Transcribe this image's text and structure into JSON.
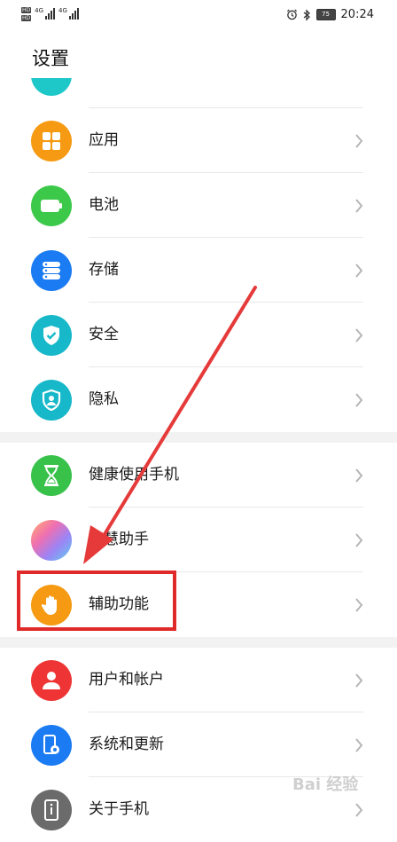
{
  "status_bar": {
    "time": "20:24",
    "battery": "75",
    "hd1": "HD",
    "hd2": "HD",
    "net1": "4G",
    "net2": "4G"
  },
  "page": {
    "title": "设置"
  },
  "items": [
    {
      "label": "",
      "icon": "teal-partial-icon",
      "color": "#1ec8c8"
    },
    {
      "label": "应用",
      "icon": "apps-grid-icon",
      "color": "#f59a12"
    },
    {
      "label": "电池",
      "icon": "battery-icon",
      "color": "#3cc94a"
    },
    {
      "label": "存储",
      "icon": "storage-icon",
      "color": "#1a7bf2"
    },
    {
      "label": "安全",
      "icon": "shield-check-icon",
      "color": "#16b8c9"
    },
    {
      "label": "隐私",
      "icon": "privacy-shield-icon",
      "color": "#16b8c9"
    },
    {
      "label": "健康使用手机",
      "icon": "hourglass-icon",
      "color": "#38c24a"
    },
    {
      "label": "智慧助手",
      "icon": "assistant-orb-icon",
      "color": "#b89cf0"
    },
    {
      "label": "辅助功能",
      "icon": "hand-icon",
      "color": "#f59a12"
    },
    {
      "label": "用户和帐户",
      "icon": "user-icon",
      "color": "#ee3434"
    },
    {
      "label": "系统和更新",
      "icon": "phone-gear-icon",
      "color": "#1a7bf2"
    },
    {
      "label": "关于手机",
      "icon": "phone-info-icon",
      "color": "#6b6b6b"
    }
  ],
  "annotation": {
    "color": "#e02a2a"
  },
  "watermark": {
    "text": "Bai 经验"
  }
}
